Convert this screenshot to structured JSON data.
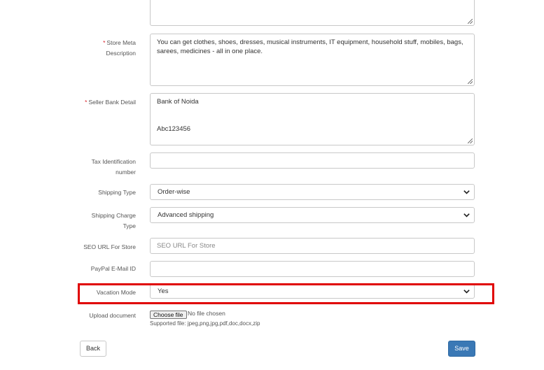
{
  "form": {
    "store_meta_description": {
      "required_mark": "*",
      "label_line1": "Store Meta",
      "label_line2": "Description",
      "value": "You can get clothes, shoes, dresses, musical instruments, IT equipment, household stuff, mobiles, bags, sarees, medicines - all in one place."
    },
    "seller_bank_detail": {
      "required_mark": "*",
      "label": "Seller Bank Detail",
      "value": "Bank of Noida\n\n\nAbc123456"
    },
    "tax_identification_number": {
      "label_line1": "Tax Identification",
      "label_line2": "number",
      "value": ""
    },
    "shipping_type": {
      "label": "Shipping Type",
      "selected": "Order-wise"
    },
    "shipping_charge_type": {
      "label_line1": "Shipping Charge",
      "label_line2": "Type",
      "selected": "Advanced shipping"
    },
    "seo_url": {
      "label": "SEO URL For Store",
      "placeholder": "SEO URL For Store",
      "value": ""
    },
    "paypal_email": {
      "label": "PayPal E-Mail ID",
      "value": ""
    },
    "vacation_mode": {
      "label": "Vacation Mode",
      "selected": "Yes"
    },
    "upload_document": {
      "label": "Upload document",
      "button_label": "Choose file",
      "status": "No file chosen",
      "supported": "Supported file: jpeg,png,jpg,pdf,doc,docx,zip"
    }
  },
  "actions": {
    "back_label": "Back",
    "save_label": "Save"
  },
  "colors": {
    "required": "#d9242c",
    "highlight": "#e00000",
    "primary": "#3a78b5"
  },
  "icons": {
    "select_arrow": "chevron-down-icon",
    "textarea_resize": "resize-grip-icon"
  }
}
